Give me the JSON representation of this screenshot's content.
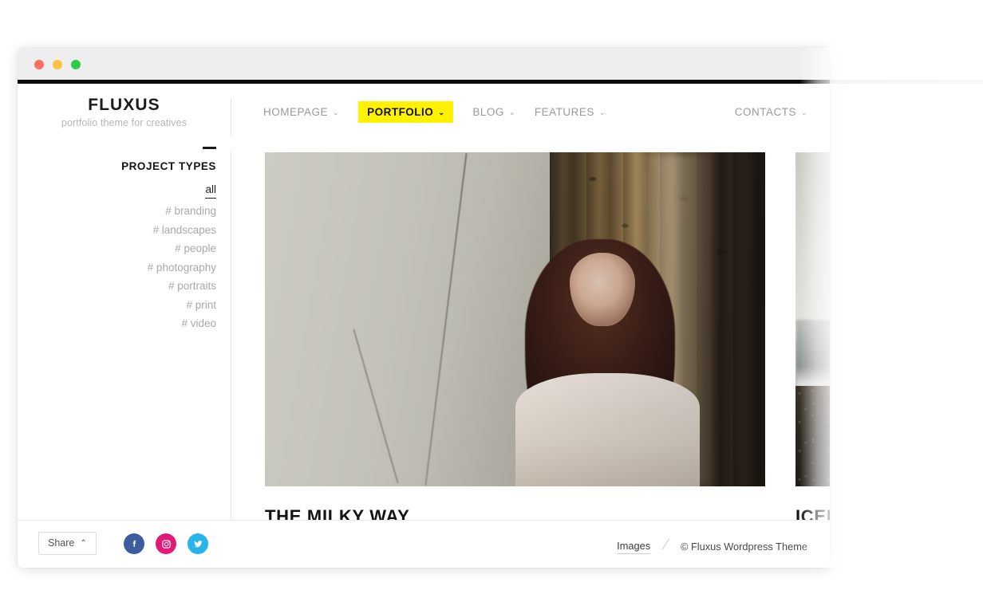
{
  "window": {
    "traffic_lights": [
      "close",
      "minimize",
      "maximize"
    ]
  },
  "header": {
    "brand_name": "FLUXUS",
    "brand_tagline": "portfolio theme for creatives",
    "nav": [
      {
        "label": "HOMEPAGE",
        "caret": "⌄",
        "active": false
      },
      {
        "label": "PORTFOLIO",
        "caret": "⌄",
        "active": true
      },
      {
        "label": "BLOG",
        "caret": "⌄",
        "active": false
      },
      {
        "label": "FEATURES",
        "caret": "⌄",
        "active": false
      }
    ],
    "nav_right": {
      "label": "CONTACTS",
      "caret": "⌄"
    },
    "accent_color": "#fff200"
  },
  "sidebar": {
    "title": "PROJECT TYPES",
    "filters": [
      {
        "label": "all",
        "active": true
      },
      {
        "label": "# branding",
        "active": false
      },
      {
        "label": "# landscapes",
        "active": false
      },
      {
        "label": "# people",
        "active": false
      },
      {
        "label": "# photography",
        "active": false
      },
      {
        "label": "# portraits",
        "active": false
      },
      {
        "label": "# print",
        "active": false
      },
      {
        "label": "# video",
        "active": false
      }
    ]
  },
  "projects": [
    {
      "title": "THE MILKY WAY"
    },
    {
      "title": "ICELAND"
    }
  ],
  "footer": {
    "share_label": "Share",
    "share_caret": "⌃",
    "socials": [
      {
        "name": "facebook",
        "color": "#3b5ca0"
      },
      {
        "name": "instagram",
        "color": "#e01a77"
      },
      {
        "name": "twitter",
        "color": "#29b4ea"
      }
    ],
    "images_link": "Images",
    "separator": "/",
    "copyright": "© Fluxus Wordpress Theme"
  }
}
